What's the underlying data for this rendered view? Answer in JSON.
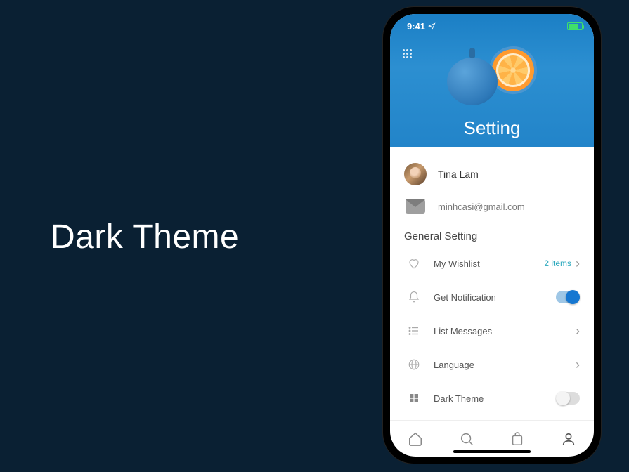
{
  "page": {
    "title": "Dark Theme"
  },
  "status": {
    "time": "9:41"
  },
  "header": {
    "title": "Setting"
  },
  "profile": {
    "name": "Tina Lam",
    "email": "minhcasi@gmail.com"
  },
  "section": {
    "title": "General Setting"
  },
  "settings": {
    "wishlist": {
      "label": "My Wishlist",
      "meta": "2 items"
    },
    "notification": {
      "label": "Get Notification"
    },
    "messages": {
      "label": "List Messages"
    },
    "language": {
      "label": "Language"
    },
    "darkTheme": {
      "label": "Dark Theme"
    }
  }
}
